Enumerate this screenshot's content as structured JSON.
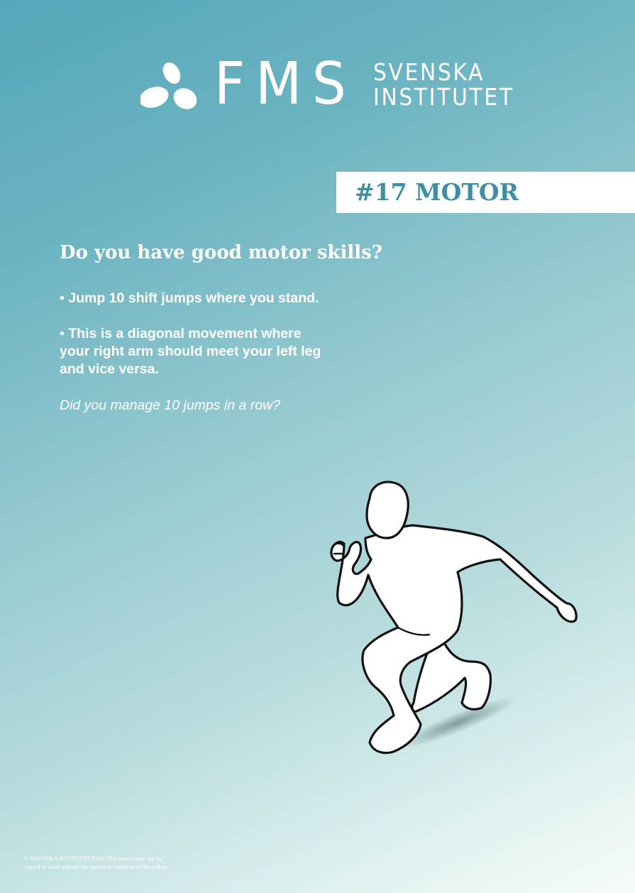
{
  "logo": {
    "brand": "FMS",
    "line1": "SVENSKA",
    "line2": "INSTITUTET"
  },
  "banner": {
    "title": "#17 MOTOR"
  },
  "content": {
    "heading": "Do you have good motor skills?",
    "bullets": [
      "• Jump 10 shift jumps where you stand.",
      "• This is a diagonal movement where\nyour right arm should meet your left leg\nand vice versa."
    ],
    "question": "Did you manage 10 jumps in a row?"
  },
  "footer": {
    "copyright": "© SVENSKA INTITUTET FMS. This poster may not be\ncopied or used without the special permission of the author."
  },
  "colors": {
    "accent": "#3d8fa6",
    "background_top": "#54a7b9",
    "background_bottom": "#f7fbfb"
  },
  "icons": {
    "logo_mark": "three-petal-logo-icon",
    "figure": "jumping-person-illustration"
  }
}
